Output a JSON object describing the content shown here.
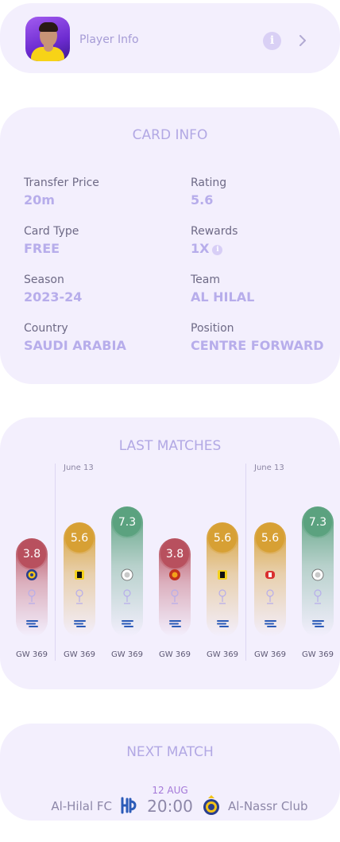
{
  "header": {
    "title": "Player Info",
    "info_icon": "info-icon",
    "nav_icon": "chevron-right-icon"
  },
  "card_info": {
    "title": "CARD INFO",
    "fields": [
      {
        "label": "Transfer Price",
        "value": "20m"
      },
      {
        "label": "Rating",
        "value": "5.6"
      },
      {
        "label": "Card Type",
        "value": "FREE"
      },
      {
        "label": "Rewards",
        "value": "1X"
      },
      {
        "label": "Season",
        "value": "2023-24"
      },
      {
        "label": "Team",
        "value": "AL HILAL"
      },
      {
        "label": "Country",
        "value": "SAUDI ARABIA"
      },
      {
        "label": "Position",
        "value": "CENTRE FORWARD"
      }
    ]
  },
  "last_matches": {
    "title": "LAST MATCHES",
    "dates": [
      "June 13",
      "June 13"
    ],
    "matches": [
      {
        "rating": "3.8",
        "rating_value": 3.8,
        "level": "low",
        "color": "#b8505e",
        "opponent_icon": "al-nassr-logo-icon",
        "gw": "GW 369"
      },
      {
        "rating": "5.6",
        "rating_value": 5.6,
        "level": "mid",
        "color": "#d7a034",
        "opponent_icon": "al-ittihad-logo-icon",
        "gw": "GW 369"
      },
      {
        "rating": "7.3",
        "rating_value": 7.3,
        "level": "high",
        "color": "#5ba27f",
        "opponent_icon": "al-shabab-logo-icon",
        "gw": "GW 369"
      },
      {
        "rating": "3.8",
        "rating_value": 3.8,
        "level": "low",
        "color": "#b8505e",
        "opponent_icon": "al-raed-logo-icon",
        "gw": "GW 369"
      },
      {
        "rating": "5.6",
        "rating_value": 5.6,
        "level": "mid",
        "color": "#d7a034",
        "opponent_icon": "al-ittihad-logo-icon",
        "gw": "GW 369"
      },
      {
        "rating": "5.6",
        "rating_value": 5.6,
        "level": "mid",
        "color": "#d7a034",
        "opponent_icon": "al-ettifaq-logo-icon",
        "gw": "GW 369"
      },
      {
        "rating": "7.3",
        "rating_value": 7.3,
        "level": "high",
        "color": "#5ba27f",
        "opponent_icon": "al-shabab-logo-icon",
        "gw": "GW 369"
      }
    ]
  },
  "next_match": {
    "title": "NEXT MATCH",
    "home_team": "Al-Hilal FC",
    "away_team": "Al-Nassr Club",
    "date": "12 AUG",
    "time": "20:00",
    "home_icon": "al-hilal-logo-icon",
    "away_icon": "al-nassr-logo-icon"
  },
  "colors": {
    "accent": "#b7adeb",
    "card_bg": "#f3effd",
    "date_accent": "#a478d8"
  }
}
